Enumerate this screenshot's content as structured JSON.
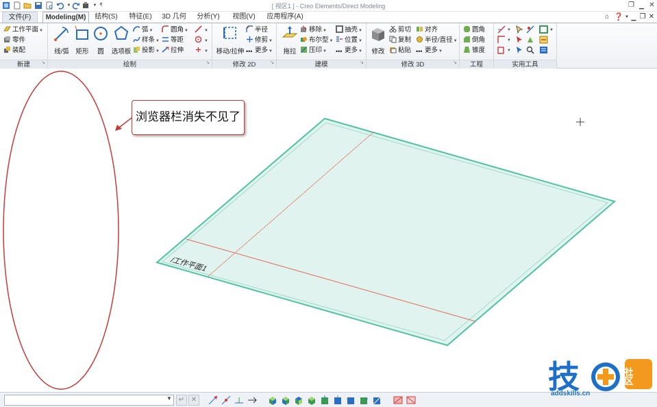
{
  "window": {
    "title": "[ 视区1 ] - Creo Elements/Direct Modeling"
  },
  "tabs": [
    {
      "label": "文件(F)"
    },
    {
      "label": "Modeling(M)"
    },
    {
      "label": "结构(S)"
    },
    {
      "label": "特征(E)"
    },
    {
      "label": "3D 几何"
    },
    {
      "label": "分析(Y)"
    },
    {
      "label": "视图(V)"
    },
    {
      "label": "应用程序(A)"
    }
  ],
  "ribbon": {
    "new_group": {
      "label": "新建",
      "items": [
        "工作平面",
        "零件",
        "装配"
      ]
    },
    "draw_group": {
      "label": "绘制",
      "big": [
        "线/弧",
        "矩形",
        "圆",
        "选项板"
      ],
      "small": [
        "弧",
        "样条",
        "投影",
        "圆角",
        "等距",
        "拉伸"
      ]
    },
    "modify2d_group": {
      "label": "修改 2D",
      "big": "移动/拉伸",
      "small": [
        "半径",
        "修剪",
        "更多"
      ]
    },
    "model_group": {
      "label": "建模",
      "big": "拖拉",
      "small": [
        "移除",
        "布尔型",
        "压印",
        "抽壳",
        "位置",
        "更多"
      ]
    },
    "modify3d_group": {
      "label": "修改 3D",
      "big": "修改",
      "small": [
        "剪切",
        "复制",
        "粘贴",
        "对齐",
        "半径/直径",
        "更多"
      ]
    },
    "engineering_group": {
      "label": "工程",
      "small": [
        "圆角",
        "倒角",
        "锥度"
      ]
    },
    "tools_group": {
      "label": "实用工具"
    }
  },
  "canvas": {
    "callout_text": "浏览器栏消失不见了",
    "workplane_label": "/工作平面1"
  },
  "statusbar": {
    "command_value": ""
  },
  "watermark": {
    "brand": "技",
    "brand2": "社区",
    "url": "addskills.cn"
  },
  "colors": {
    "accent": "#1d6fc8",
    "plane_fill": "#dff3ef",
    "plane_edge": "#4fc3a1",
    "annotation": "#c83a3a",
    "watermark_orange": "#f39a1e"
  }
}
